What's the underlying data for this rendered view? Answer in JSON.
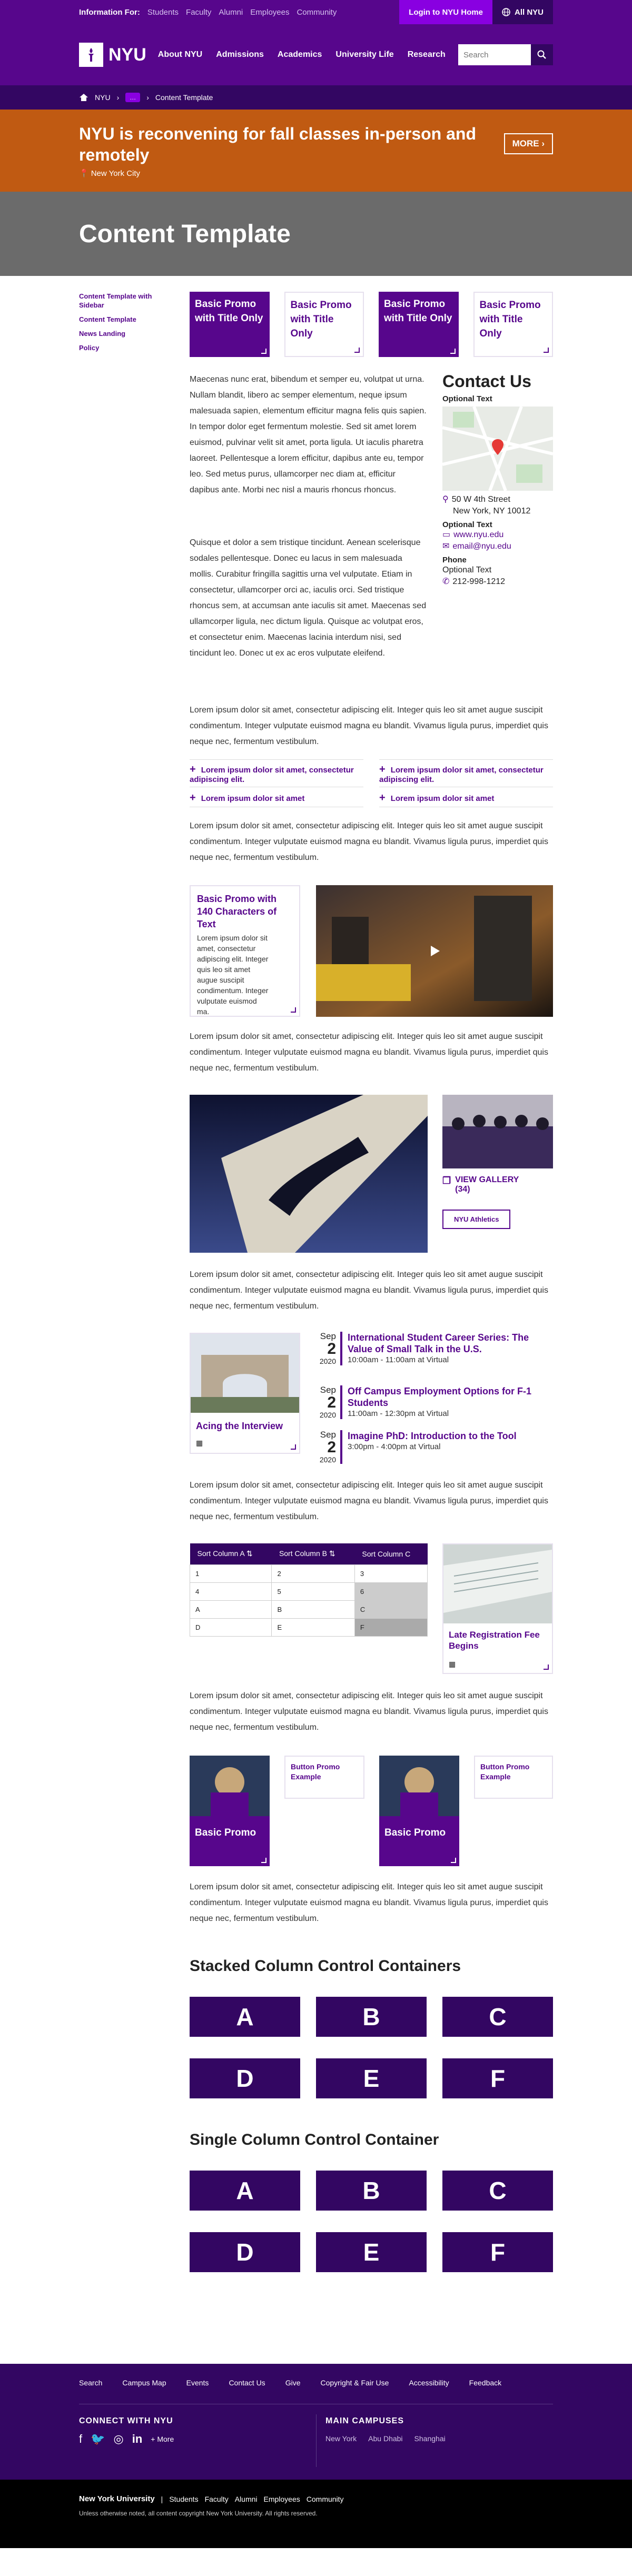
{
  "util": {
    "label": "Information For:",
    "links": [
      "Students",
      "Faculty",
      "Alumni",
      "Employees",
      "Community"
    ],
    "login": "Login to NYU Home",
    "allnyu": "All NYU"
  },
  "header": {
    "logo": "NYU",
    "nav": [
      "About NYU",
      "Admissions",
      "Academics",
      "University Life",
      "Research"
    ],
    "search_placeholder": "Search"
  },
  "breadcrumb": {
    "home": "NYU",
    "more": "…",
    "current": "Content Template"
  },
  "alert": {
    "title": "NYU is reconvening for fall classes in-person and remotely",
    "location": "New York City",
    "more": "MORE"
  },
  "page_title": "Content Template",
  "sidebar": [
    "Content Template with Sidebar",
    "Content Template",
    "News Landing",
    "Policy"
  ],
  "promos": [
    {
      "label": "Basic Promo with Title Only",
      "style": "dark"
    },
    {
      "label": "Basic Promo with Title Only",
      "style": "light"
    },
    {
      "label": "Basic Promo with Title Only",
      "style": "dark"
    },
    {
      "label": "Basic Promo with Title Only",
      "style": "light"
    }
  ],
  "intro_p1": "Maecenas nunc erat, bibendum et semper eu, volutpat ut urna. Nullam blandit, libero ac semper elementum, neque ipsum malesuada sapien, elementum efficitur magna felis quis sapien. In tempor dolor eget fermentum molestie. Sed sit amet lorem euismod, pulvinar velit sit amet, porta ligula. Ut iaculis pharetra laoreet. Pellentesque a lorem efficitur, dapibus ante eu, tempor leo. Sed metus purus, ullamcorper nec diam at, efficitur dapibus ante. Morbi nec nisl a mauris rhoncus rhoncus.",
  "intro_p2": "Quisque et dolor a sem tristique tincidunt. Aenean scelerisque sodales pellentesque. Donec eu lacus in sem malesuada mollis. Curabitur fringilla sagittis urna vel vulputate. Etiam in consectetur, ullamcorper orci ac, iaculis orci. Sed tristique rhoncus sem, at accumsan ante iaculis sit amet. Maecenas sed ullamcorper ligula, nec dictum ligula. Quisque ac volutpat eros, et consectetur enim. Maecenas lacinia interdum nisi, sed tincidunt leo. Donec ut ex ac eros vulputate eleifend.",
  "lorem": "Lorem ipsum dolor sit amet, consectetur adipiscing elit. Integer quis leo sit amet augue suscipit condimentum. Integer vulputate euismod magna eu blandit. Vivamus ligula purus, imperdiet quis neque nec, fermentum vestibulum.",
  "contact": {
    "title": "Contact Us",
    "optional": "Optional Text",
    "address1": "50 W 4th Street",
    "address2": "New York, NY 10012",
    "web": "www.nyu.edu",
    "email": "email@nyu.edu",
    "phone_label": "Phone",
    "phone": "212-998-1212"
  },
  "accordion": [
    "Lorem ipsum dolor sit amet, consectetur adipiscing elit.",
    "Lorem ipsum dolor sit amet, consectetur adipiscing elit.",
    "Lorem ipsum dolor sit amet",
    "Lorem ipsum dolor sit amet"
  ],
  "promo140": {
    "title": "Basic Promo with 140 Characters of Text",
    "body": "Lorem ipsum dolor sit amet, consectetur adipiscing elit. Integer quis leo sit amet augue suscipit condimentum. Integer vulputate euismod ma."
  },
  "gallery": {
    "view": "VIEW GALLERY",
    "count": "(34)",
    "tag": "NYU Athletics"
  },
  "events": [
    {
      "month": "Sep",
      "day": "2",
      "year": "2020",
      "title": "International Student Career Series: The Value of Small Talk in the U.S.",
      "time": "10:00am - 11:00am at Virtual"
    },
    {
      "month": "Sep",
      "day": "2",
      "year": "2020",
      "title": "Off Campus Employment Options for F-1 Students",
      "time": "11:00am - 12:30pm at Virtual"
    },
    {
      "month": "Sep",
      "day": "2",
      "year": "2020",
      "title": "Imagine PhD: Introduction to the Tool",
      "time": "3:00pm - 4:00pm at Virtual"
    }
  ],
  "acing": "Acing the Interview",
  "table": {
    "headers": [
      "Sort Column A",
      "Sort Column B",
      "Sort Column C"
    ],
    "rows": [
      [
        "1",
        "2",
        "3"
      ],
      [
        "4",
        "5",
        "6"
      ],
      [
        "A",
        "B",
        "C"
      ],
      [
        "D",
        "E",
        "F"
      ]
    ]
  },
  "late_reg": "Late Registration Fee Begins",
  "promos2": [
    "Basic Promo",
    "Button Promo Example",
    "Basic Promo",
    "Button Promo Example"
  ],
  "stacked_title": "Stacked Column Control Containers",
  "single_title": "Single Column Control Container",
  "letters": [
    "A",
    "B",
    "C",
    "D",
    "E",
    "F"
  ],
  "footer": {
    "links": [
      "Search",
      "Campus Map",
      "Events",
      "Contact Us",
      "Give",
      "Copyright & Fair Use",
      "Accessibility",
      "Feedback"
    ],
    "connect": "CONNECT WITH NYU",
    "social_more": "+ More",
    "campuses_title": "MAIN CAMPUSES",
    "campuses": [
      "New York",
      "Abu Dhabi",
      "Shanghai"
    ],
    "univ": "New York University",
    "bottom_links": [
      "Students",
      "Faculty",
      "Alumni",
      "Employees",
      "Community"
    ],
    "copyright": "Unless otherwise noted, all content copyright New York University. All rights reserved."
  },
  "colors": {
    "nyu_purple": "#57068c",
    "dark_purple": "#330662",
    "alert_orange": "#c05a12"
  }
}
